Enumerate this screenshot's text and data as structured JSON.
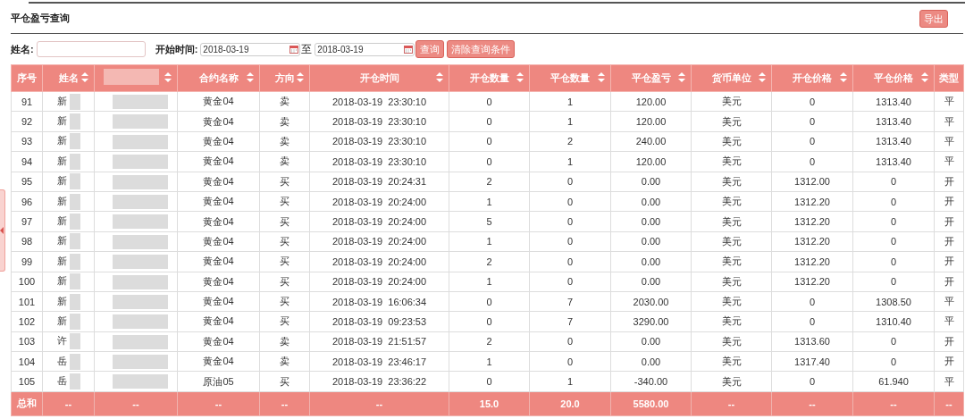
{
  "title": "平仓盈亏查询",
  "export_button": "导出",
  "filters": {
    "name_label": "姓名:",
    "start_label": "开始时间:",
    "start_date": "2018-03-19",
    "to_label": "至",
    "end_date": "2018-03-19",
    "query_button": "查询",
    "clear_button": "清除查询条件"
  },
  "table": {
    "columns": [
      {
        "label": "序号",
        "sortable": false
      },
      {
        "label": "姓名",
        "sortable": true
      },
      {
        "sortable": true,
        "redacted": true
      },
      {
        "label": "合约名称",
        "sortable": true
      },
      {
        "label": "方向",
        "sortable": true
      },
      {
        "label": "开仓时间",
        "sortable": true
      },
      {
        "label": "开仓数量",
        "sortable": true
      },
      {
        "label": "平仓数量",
        "sortable": true
      },
      {
        "label": "平仓盈亏",
        "sortable": true
      },
      {
        "label": "货币单位",
        "sortable": true
      },
      {
        "label": "开仓价格",
        "sortable": true
      },
      {
        "label": "平仓价格",
        "sortable": true
      },
      {
        "label": "类型",
        "sortable": false
      }
    ],
    "rows": [
      [
        "91",
        "新",
        "",
        "黄金04",
        "卖",
        "2018-03-19  23:30:10",
        "0",
        "1",
        "120.00",
        "美元",
        "0",
        "1313.40",
        "平"
      ],
      [
        "92",
        "新",
        "",
        "黄金04",
        "卖",
        "2018-03-19  23:30:10",
        "0",
        "1",
        "120.00",
        "美元",
        "0",
        "1313.40",
        "平"
      ],
      [
        "93",
        "新",
        "",
        "黄金04",
        "卖",
        "2018-03-19  23:30:10",
        "0",
        "2",
        "240.00",
        "美元",
        "0",
        "1313.40",
        "平"
      ],
      [
        "94",
        "新",
        "",
        "黄金04",
        "卖",
        "2018-03-19  23:30:10",
        "0",
        "1",
        "120.00",
        "美元",
        "0",
        "1313.40",
        "平"
      ],
      [
        "95",
        "新",
        "",
        "黄金04",
        "买",
        "2018-03-19  20:24:31",
        "2",
        "0",
        "0.00",
        "美元",
        "1312.00",
        "0",
        "开"
      ],
      [
        "96",
        "新",
        "",
        "黄金04",
        "买",
        "2018-03-19  20:24:00",
        "1",
        "0",
        "0.00",
        "美元",
        "1312.20",
        "0",
        "开"
      ],
      [
        "97",
        "新",
        "",
        "黄金04",
        "买",
        "2018-03-19  20:24:00",
        "5",
        "0",
        "0.00",
        "美元",
        "1312.20",
        "0",
        "开"
      ],
      [
        "98",
        "新",
        "",
        "黄金04",
        "买",
        "2018-03-19  20:24:00",
        "1",
        "0",
        "0.00",
        "美元",
        "1312.20",
        "0",
        "开"
      ],
      [
        "99",
        "新",
        "",
        "黄金04",
        "买",
        "2018-03-19  20:24:00",
        "2",
        "0",
        "0.00",
        "美元",
        "1312.20",
        "0",
        "开"
      ],
      [
        "100",
        "新",
        "",
        "黄金04",
        "买",
        "2018-03-19  20:24:00",
        "1",
        "0",
        "0.00",
        "美元",
        "1312.20",
        "0",
        "开"
      ],
      [
        "101",
        "新",
        "",
        "黄金04",
        "买",
        "2018-03-19  16:06:34",
        "0",
        "7",
        "2030.00",
        "美元",
        "0",
        "1308.50",
        "平"
      ],
      [
        "102",
        "新",
        "",
        "黄金04",
        "买",
        "2018-03-19  09:23:53",
        "0",
        "7",
        "3290.00",
        "美元",
        "0",
        "1310.40",
        "平"
      ],
      [
        "103",
        "许",
        "",
        "黄金04",
        "卖",
        "2018-03-19  21:51:57",
        "2",
        "0",
        "0.00",
        "美元",
        "1313.60",
        "0",
        "开"
      ],
      [
        "104",
        "岳",
        "",
        "黄金04",
        "卖",
        "2018-03-19  23:46:17",
        "1",
        "0",
        "0.00",
        "美元",
        "1317.40",
        "0",
        "开"
      ],
      [
        "105",
        "岳",
        "",
        "原油05",
        "买",
        "2018-03-19  23:36:22",
        "0",
        "1",
        "-340.00",
        "美元",
        "0",
        "61.940",
        "平"
      ]
    ],
    "total": [
      "总和",
      "--",
      "--",
      "--",
      "--",
      "--",
      "15.0",
      "20.0",
      "5580.00",
      "--",
      "--",
      "--",
      "--"
    ]
  }
}
